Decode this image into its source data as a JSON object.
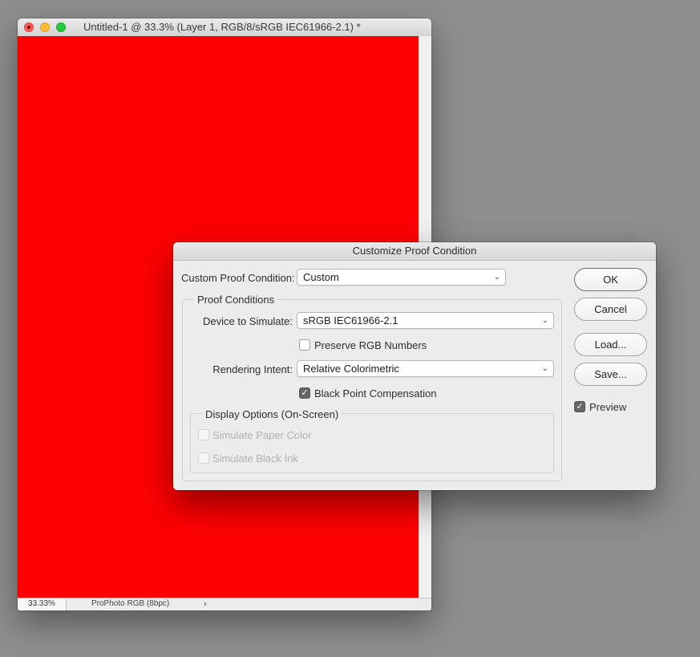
{
  "document_window": {
    "title": "Untitled-1 @ 33.3% (Layer 1, RGB/8/sRGB IEC61966-2.1) *",
    "canvas_color": "#ff0000",
    "status": {
      "zoom": "33.33%",
      "profile": "ProPhoto RGB (8bpc)",
      "arrow": "›"
    }
  },
  "dialog": {
    "title": "Customize Proof Condition",
    "custom_proof_label": "Custom Proof Condition:",
    "custom_proof_value": "Custom",
    "proof_conditions_title": "Proof Conditions",
    "device_label": "Device to Simulate:",
    "device_value": "sRGB IEC61966-2.1",
    "preserve_rgb_label": "Preserve RGB Numbers",
    "preserve_rgb_checked": false,
    "rendering_intent_label": "Rendering Intent:",
    "rendering_intent_value": "Relative Colorimetric",
    "black_point_label": "Black Point Compensation",
    "black_point_checked": true,
    "display_options_title": "Display Options (On-Screen)",
    "simulate_paper_label": "Simulate Paper Color",
    "simulate_black_label": "Simulate Black Ink",
    "buttons": {
      "ok": "OK",
      "cancel": "Cancel",
      "load": "Load...",
      "save": "Save..."
    },
    "preview_label": "Preview",
    "preview_checked": true,
    "chevron": "⌄",
    "check_glyph": "✓"
  }
}
